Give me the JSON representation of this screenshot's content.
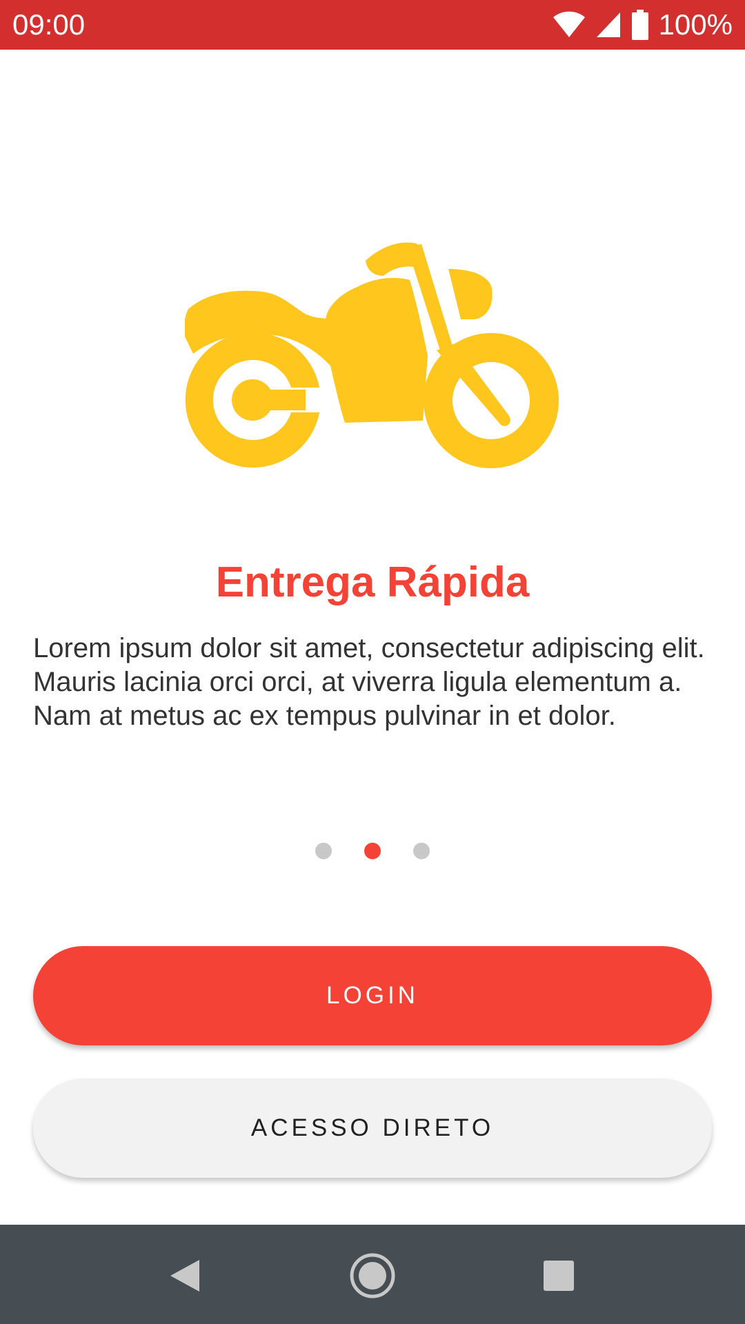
{
  "status_bar": {
    "time": "09:00",
    "battery": "100%",
    "icons": [
      "wifi-icon",
      "signal-icon",
      "battery-icon"
    ],
    "background": "#d32f2f"
  },
  "onboarding": {
    "illustration": "motorcycle-icon",
    "illustration_color": "#ffc61e",
    "title": "Entrega Rápida",
    "description": "Lorem ipsum dolor sit amet, consectetur adipiscing elit. Mauris lacinia orci orci, at viverra ligula elementum a. Nam at metus ac ex tempus pulvinar in et dolor.",
    "pages_total": 3,
    "current_page": 2
  },
  "buttons": {
    "login_label": "LOGIN",
    "direct_access_label": "ACESSO DIRETO"
  },
  "colors": {
    "accent": "#f44336",
    "secondary_button": "#f2f2f2",
    "nav_bar": "#464d53"
  },
  "nav_bar": {
    "icons": [
      "back-icon",
      "home-icon",
      "recents-icon"
    ]
  }
}
